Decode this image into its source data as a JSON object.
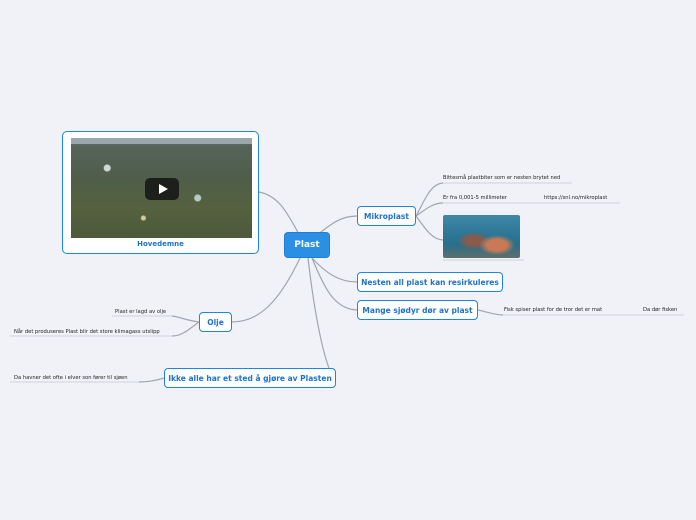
{
  "central": {
    "label": "Plast"
  },
  "image_node": {
    "caption": "Hovedemne",
    "photo": "plastic-pollution-beach-video-thumbnail",
    "play_icon": "play-icon"
  },
  "branches": {
    "mikroplast": {
      "label": "Mikroplast",
      "leaves": [
        "Bittesmå plastbiter som er nesten brytet ned",
        "Er fra 0,001-5 millimeter",
        "https://snl.no/mikroplast"
      ],
      "image": "coral-reef-with-plastic-photo"
    },
    "resirkuleres": {
      "label": "Nesten all plast kan resirkuleres"
    },
    "dyr": {
      "label": "Mange sjødyr dør av plast",
      "leaves": [
        "Fisk spiser plast for de tror det er mat",
        "Da dør fisken"
      ]
    },
    "olje": {
      "label": "Olje",
      "leaves": [
        "Plast er lagd av olje",
        "Når det produseres Plast blir det store klimagass utslipp"
      ]
    },
    "sted": {
      "label": "Ikke alle har et sted å gjøre av Plasten",
      "leaves": [
        "Da havner det ofte i elver son fører til sjøen"
      ]
    }
  },
  "colors": {
    "accent": "#1c86e0",
    "central_fill": "#2b8fe4",
    "link": "#9fa6b2",
    "background": "#f0f2f8"
  }
}
